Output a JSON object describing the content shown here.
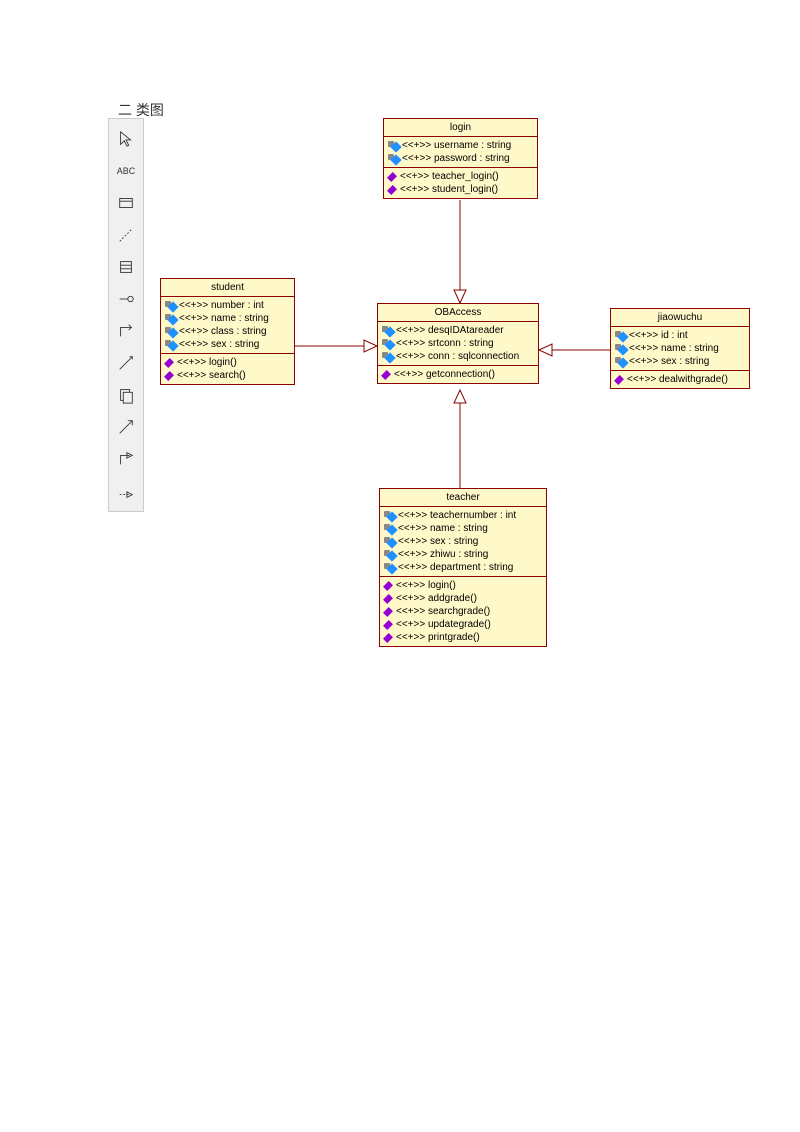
{
  "title": "二 类图",
  "toolbar": {
    "tools": [
      "pointer",
      "ABC",
      "note",
      "line",
      "package",
      "lollipop",
      "elbow",
      "dashed",
      "copy",
      "arrow",
      "elbow2",
      "dashed-arrow"
    ]
  },
  "classes": {
    "login": {
      "name": "login",
      "attrs": [
        {
          "stereo": "<<+>>",
          "text": "username : string"
        },
        {
          "stereo": "<<+>>",
          "text": "password : string"
        }
      ],
      "methods": [
        {
          "stereo": "<<+>>",
          "text": "teacher_login()"
        },
        {
          "stereo": "<<+>>",
          "text": "student_login()"
        }
      ]
    },
    "student": {
      "name": "student",
      "attrs": [
        {
          "stereo": "<<+>>",
          "text": "number : int"
        },
        {
          "stereo": "<<+>>",
          "text": "name : string"
        },
        {
          "stereo": "<<+>>",
          "text": "class : string"
        },
        {
          "stereo": "<<+>>",
          "text": "sex : string"
        }
      ],
      "methods": [
        {
          "stereo": "<<+>>",
          "text": "login()"
        },
        {
          "stereo": "<<+>>",
          "text": "search()"
        }
      ]
    },
    "obaccess": {
      "name": "OBAccess",
      "attrs": [
        {
          "stereo": "<<+>>",
          "text": "desqIDAtareader"
        },
        {
          "stereo": "<<+>>",
          "text": "srtconn : string"
        },
        {
          "stereo": "<<+>>",
          "text": "conn : sqlconnection"
        }
      ],
      "methods": [
        {
          "stereo": "<<+>>",
          "text": "getconnection()"
        }
      ]
    },
    "jiaowuchu": {
      "name": "jiaowuchu",
      "attrs": [
        {
          "stereo": "<<+>>",
          "text": "id : int"
        },
        {
          "stereo": "<<+>>",
          "text": "name : string"
        },
        {
          "stereo": "<<+>>",
          "text": "sex : string"
        }
      ],
      "methods": [
        {
          "stereo": "<<+>>",
          "text": "dealwithgrade()"
        }
      ]
    },
    "teacher": {
      "name": "teacher",
      "attrs": [
        {
          "stereo": "<<+>>",
          "text": "teachernumber : int"
        },
        {
          "stereo": "<<+>>",
          "text": "name : string"
        },
        {
          "stereo": "<<+>>",
          "text": "sex : string"
        },
        {
          "stereo": "<<+>>",
          "text": "zhiwu : string"
        },
        {
          "stereo": "<<+>>",
          "text": "department : string"
        }
      ],
      "methods": [
        {
          "stereo": "<<+>>",
          "text": "login()"
        },
        {
          "stereo": "<<+>>",
          "text": "addgrade()"
        },
        {
          "stereo": "<<+>>",
          "text": "searchgrade()"
        },
        {
          "stereo": "<<+>>",
          "text": "updategrade()"
        },
        {
          "stereo": "<<+>>",
          "text": "printgrade()"
        }
      ]
    }
  },
  "relations": [
    {
      "from": "login",
      "to": "obaccess",
      "type": "generalization"
    },
    {
      "from": "student",
      "to": "obaccess",
      "type": "generalization"
    },
    {
      "from": "jiaowuchu",
      "to": "obaccess",
      "type": "generalization"
    },
    {
      "from": "teacher",
      "to": "obaccess",
      "type": "generalization"
    }
  ]
}
